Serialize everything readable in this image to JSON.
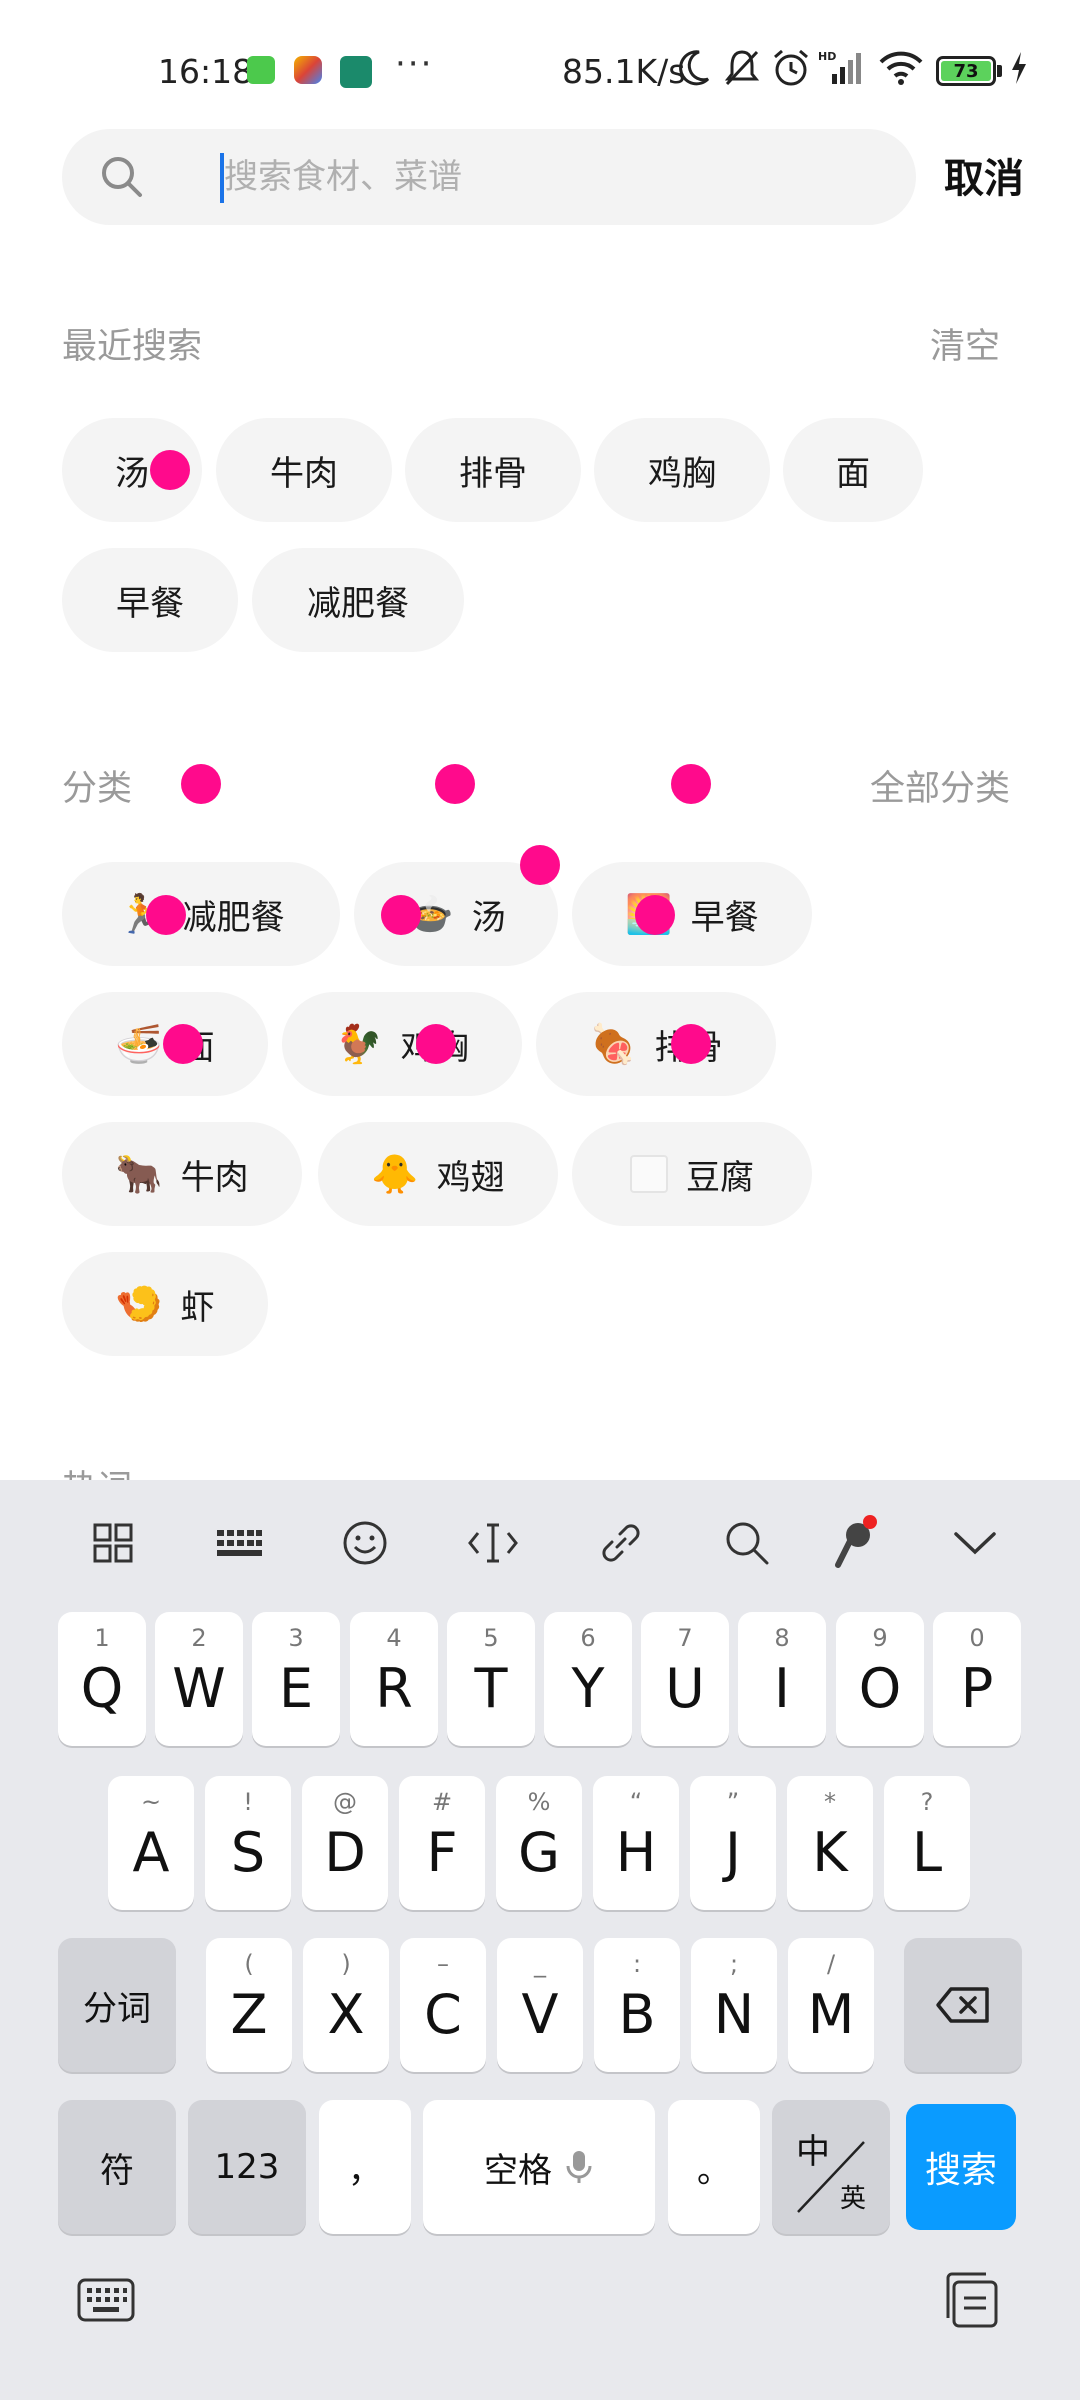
{
  "status_bar": {
    "time": "16:18",
    "more": "···",
    "net_speed": "85.1K/s",
    "battery": "73",
    "icons": [
      "moon-icon",
      "mute-icon",
      "alarm-icon",
      "signal-icon",
      "wifi-icon",
      "charging-icon"
    ]
  },
  "search": {
    "placeholder": "搜索食材、菜谱",
    "value": "",
    "cancel_label": "取消"
  },
  "recent": {
    "title": "最近搜索",
    "clear_label": "清空",
    "items": [
      "汤",
      "牛肉",
      "排骨",
      "鸡胸",
      "面",
      "早餐",
      "减肥餐"
    ]
  },
  "categories": {
    "title": "分类",
    "all_label": "全部分类",
    "items": [
      {
        "emoji": "🏃",
        "label": "减肥餐"
      },
      {
        "emoji": "🍲",
        "label": "汤"
      },
      {
        "emoji": "🌅",
        "label": "早餐"
      },
      {
        "emoji": "🍜",
        "label": "面"
      },
      {
        "emoji": "🐓",
        "label": "鸡胸"
      },
      {
        "emoji": "🍖",
        "label": "排骨"
      },
      {
        "emoji": "🐂",
        "label": "牛肉"
      },
      {
        "emoji": "🐥",
        "label": "鸡翅"
      },
      {
        "emoji": "",
        "label": "豆腐"
      },
      {
        "emoji": "🍤",
        "label": "虾"
      }
    ]
  },
  "hot": {
    "title": "热词"
  },
  "keyboard": {
    "row1": [
      {
        "sub": "1",
        "key": "Q"
      },
      {
        "sub": "2",
        "key": "W"
      },
      {
        "sub": "3",
        "key": "E"
      },
      {
        "sub": "4",
        "key": "R"
      },
      {
        "sub": "5",
        "key": "T"
      },
      {
        "sub": "6",
        "key": "Y"
      },
      {
        "sub": "7",
        "key": "U"
      },
      {
        "sub": "8",
        "key": "I"
      },
      {
        "sub": "9",
        "key": "O"
      },
      {
        "sub": "0",
        "key": "P"
      }
    ],
    "row2": [
      {
        "sub": "~",
        "key": "A"
      },
      {
        "sub": "!",
        "key": "S"
      },
      {
        "sub": "@",
        "key": "D"
      },
      {
        "sub": "#",
        "key": "F"
      },
      {
        "sub": "%",
        "key": "G"
      },
      {
        "sub": "“",
        "key": "H"
      },
      {
        "sub": "”",
        "key": "J"
      },
      {
        "sub": "*",
        "key": "K"
      },
      {
        "sub": "?",
        "key": "L"
      }
    ],
    "row3": [
      {
        "sub": "(",
        "key": "Z"
      },
      {
        "sub": ")",
        "key": "X"
      },
      {
        "sub": "–",
        "key": "C"
      },
      {
        "sub": "_",
        "key": "V"
      },
      {
        "sub": ":",
        "key": "B"
      },
      {
        "sub": ";",
        "key": "N"
      },
      {
        "sub": "/",
        "key": "M"
      }
    ],
    "fenci_label": "分词",
    "symbol_label": "符",
    "num_label": "123",
    "comma_label": "，",
    "space_label": "空格",
    "period_label": "。",
    "lang_top": "中",
    "lang_bottom": "英",
    "search_label": "搜索"
  }
}
